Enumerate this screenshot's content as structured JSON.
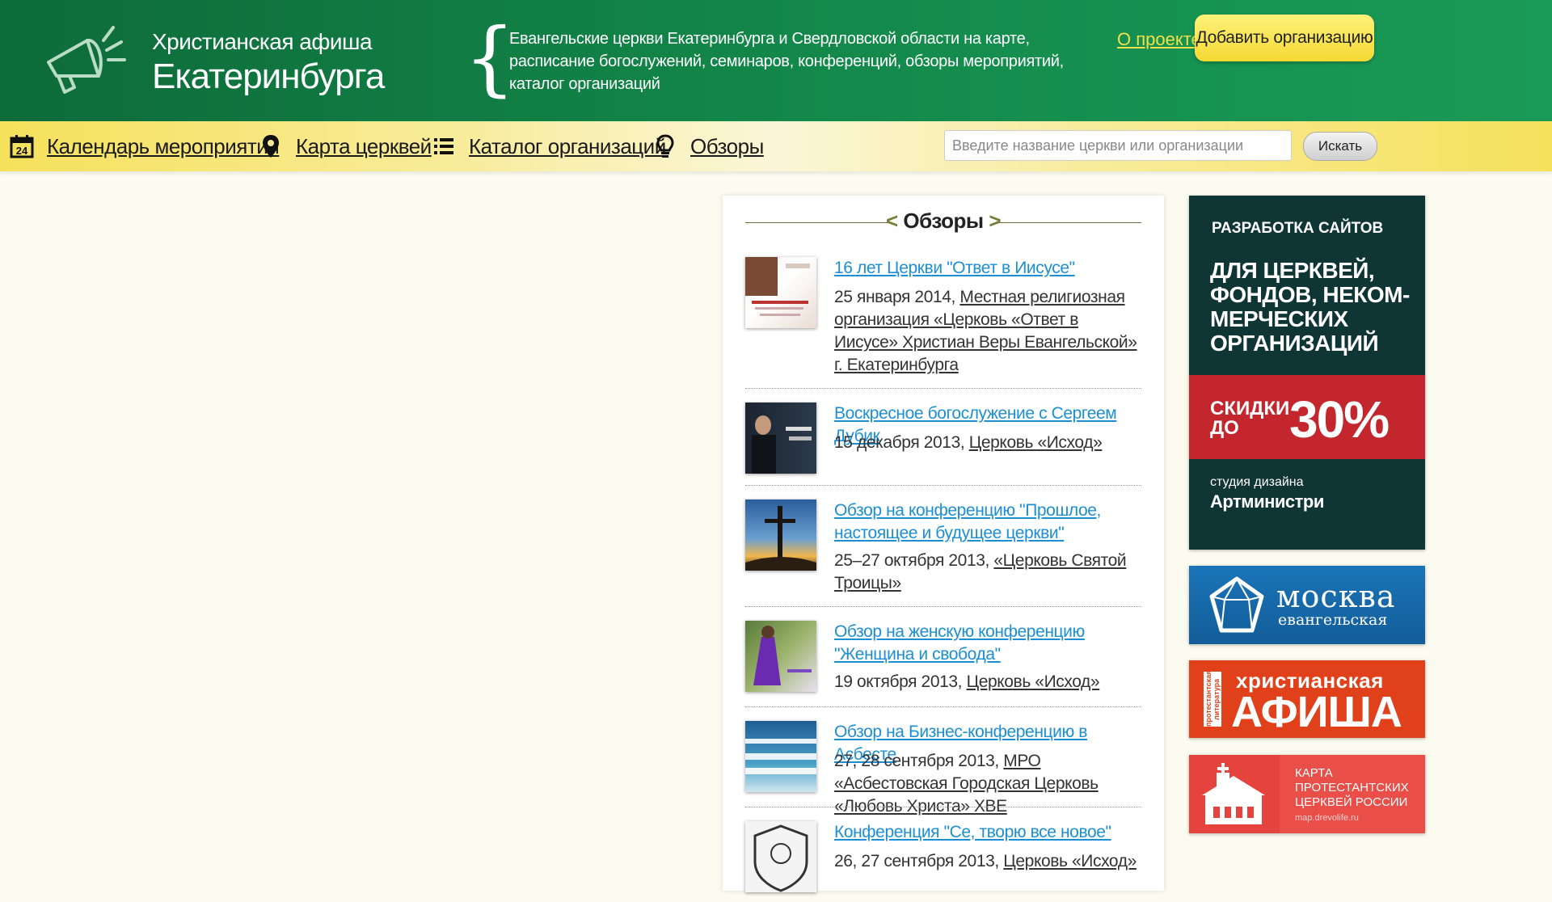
{
  "header": {
    "logo_subtitle": "Христианская афиша",
    "logo_title": "Екатеринбурга",
    "tagline": "Евангельские церкви Екатеринбурга и Свердловской области на карте, расписание богослужений, семинаров, конференций, обзоры мероприятий, каталог организаций",
    "about_link": "О проекте",
    "add_org_button": "Добавить организацию"
  },
  "nav": {
    "items": [
      {
        "label": "Календарь мероприятий",
        "icon": "calendar-icon",
        "icon_text": "24"
      },
      {
        "label": "Карта церквей",
        "icon": "map-pin-icon"
      },
      {
        "label": "Каталог организаций",
        "icon": "list-icon"
      },
      {
        "label": "Обзоры",
        "icon": "lightbulb-icon"
      }
    ],
    "search_placeholder": "Введите название церкви или организации",
    "search_button": "Искать"
  },
  "reviews": {
    "heading": "Обзоры",
    "chev_left": "<",
    "chev_right": ">",
    "items": [
      {
        "title": "16 лет Церкви \"Ответ в Иисусе\"",
        "date": "25 января 2014,",
        "org": "Местная религиозная организация «Церковь «Ответ в Иисусе» Христиан Веры Евангельской» г. Екатеринбурга"
      },
      {
        "title": "Воскресное богослужение с Сергеем Дубик",
        "date": "15 декабря 2013,",
        "org": "Церковь «Исход»"
      },
      {
        "title": "Обзор на конференцию \"Прошлое, настоящее и будущее церкви\"",
        "date": "25–27 октября 2013,",
        "org": "«Церковь Святой Троицы»"
      },
      {
        "title": "Обзор на женскую конференцию \"Женщина и свобода\"",
        "date": "19 октября 2013,",
        "org": "Церковь «Исход»"
      },
      {
        "title": "Обзор на Бизнес-конференцию в Асбесте",
        "date": "27, 28 сентября 2013,",
        "org": "МРО «Асбестовская Городская Церковь «Любовь Христа» ХВЕ"
      },
      {
        "title": "Конференция \"Се, творю все новое\"",
        "date": "26, 27 сентября 2013,",
        "org": "Церковь «Исход»"
      }
    ]
  },
  "banners": {
    "web_dev": {
      "line1": "РАЗРАБОТКА САЙТОВ",
      "line2": "ДЛЯ ЦЕРКВЕЙ, ФОНДОВ, НЕКОМ-МЕРЧЕСКИХ ОРГАНИЗАЦИЙ",
      "discount_prefix": "СКИДКИ ДО",
      "discount_value": "30%",
      "studio_label": "студия дизайна",
      "studio_name": "Артминистри"
    },
    "moscow": {
      "name": "москва",
      "sub": "евангельская"
    },
    "afisha": {
      "vertical": "протестантская литература",
      "line1": "христианская",
      "line2": "АФИША"
    },
    "map": {
      "text": "КАРТА ПРОТЕСТАНТСКИХ ЦЕРКВЕЙ РОССИИ",
      "url": "map.drevolife.ru"
    }
  },
  "colors": {
    "header_green": "#138a4b",
    "nav_yellow": "#f6e15b",
    "link_blue": "#1c8fd4",
    "button_yellow": "#f5d833"
  }
}
